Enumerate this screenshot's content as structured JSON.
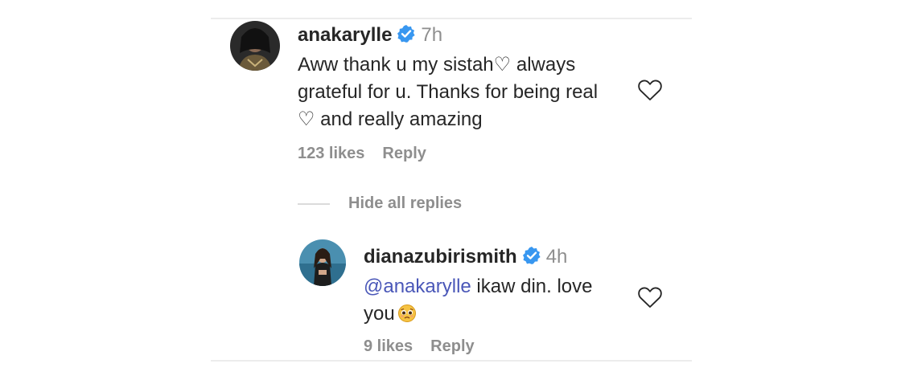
{
  "comment": {
    "username": "anakarylle",
    "time": "7h",
    "lines": [
      "Aww thank u my sistah♡ always",
      "grateful for u. Thanks for being real",
      "♡ and really amazing"
    ],
    "likes": "123 likes",
    "reply_label": "Reply"
  },
  "replies_toggle": {
    "label": "Hide all replies"
  },
  "reply": {
    "username": "dianazubirismith",
    "time": "4h",
    "mention": "@anakarylle",
    "text_rest": " ikaw din. love",
    "line2": "you",
    "emoji": "🥹",
    "likes": "9 likes",
    "reply_label": "Reply"
  },
  "colors": {
    "verified": "#3897f0",
    "mention": "#4a57b8",
    "muted": "#8e8e8e"
  }
}
